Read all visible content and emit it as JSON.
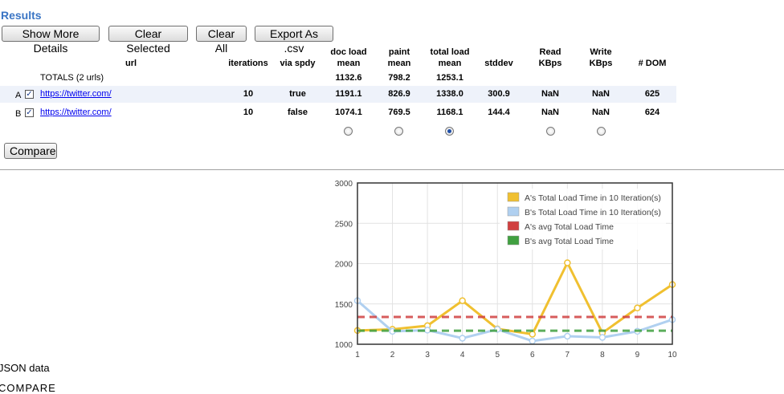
{
  "title": "Results",
  "toolbar": {
    "show_more": "Show More Details",
    "clear_selected": "Clear Selected",
    "clear_all": "Clear All",
    "export_csv": "Export As .csv"
  },
  "table": {
    "headers": {
      "url": "url",
      "iterations": "iterations",
      "via_spdy": "via spdy",
      "doc_load_1": "doc load",
      "doc_load_2": "mean",
      "paint_1": "paint",
      "paint_2": "mean",
      "total_load_1": "total load",
      "total_load_2": "mean",
      "stddev": "stddev",
      "read_1": "Read",
      "read_2": "KBps",
      "write_1": "Write",
      "write_2": "KBps",
      "dom": "# DOM"
    },
    "totals": {
      "label": "TOTALS (2 urls)",
      "doc_load": "1132.6",
      "paint": "798.2",
      "total_load": "1253.1"
    },
    "rows": [
      {
        "letter": "A",
        "checked": true,
        "url": "https://twitter.com/",
        "iterations": "10",
        "via_spdy": "true",
        "doc_load": "1191.1",
        "paint": "826.9",
        "total_load": "1338.0",
        "stddev": "300.9",
        "read": "NaN",
        "write": "NaN",
        "dom": "625"
      },
      {
        "letter": "B",
        "checked": true,
        "url": "https://twitter.com/",
        "iterations": "10",
        "via_spdy": "false",
        "doc_load": "1074.1",
        "paint": "769.5",
        "total_load": "1168.1",
        "stddev": "144.4",
        "read": "NaN",
        "write": "NaN",
        "dom": "624"
      }
    ],
    "sort_selected": "total_load"
  },
  "compare_button": "Compare",
  "chart_data": {
    "type": "line",
    "x": [
      1,
      2,
      3,
      4,
      5,
      6,
      7,
      8,
      9,
      10
    ],
    "ylim": [
      1000,
      3000
    ],
    "yticks": [
      1000,
      1500,
      2000,
      2500,
      3000
    ],
    "grid": true,
    "legend_position": "top-right",
    "series": [
      {
        "name": "A's Total Load Time in 10 Iteration(s)",
        "color": "#f0c030",
        "values": [
          1170,
          1185,
          1230,
          1540,
          1190,
          1125,
          2010,
          1140,
          1450,
          1740
        ]
      },
      {
        "name": "B's Total Load Time in 10 Iteration(s)",
        "color": "#b0d0f0",
        "values": [
          1540,
          1160,
          1175,
          1075,
          1185,
          1040,
          1100,
          1085,
          1160,
          1305
        ]
      },
      {
        "name": "A's avg Total Load Time",
        "color": "#d04040",
        "dashed": true,
        "values": [
          1338,
          1338,
          1338,
          1338,
          1338,
          1338,
          1338,
          1338,
          1338,
          1338
        ]
      },
      {
        "name": "B's avg Total Load Time",
        "color": "#40a040",
        "dashed": true,
        "values": [
          1168.1,
          1168.1,
          1168.1,
          1168.1,
          1168.1,
          1168.1,
          1168.1,
          1168.1,
          1168.1,
          1168.1
        ]
      }
    ]
  },
  "json_label": "JSON data",
  "compare_label": "COMPARE"
}
